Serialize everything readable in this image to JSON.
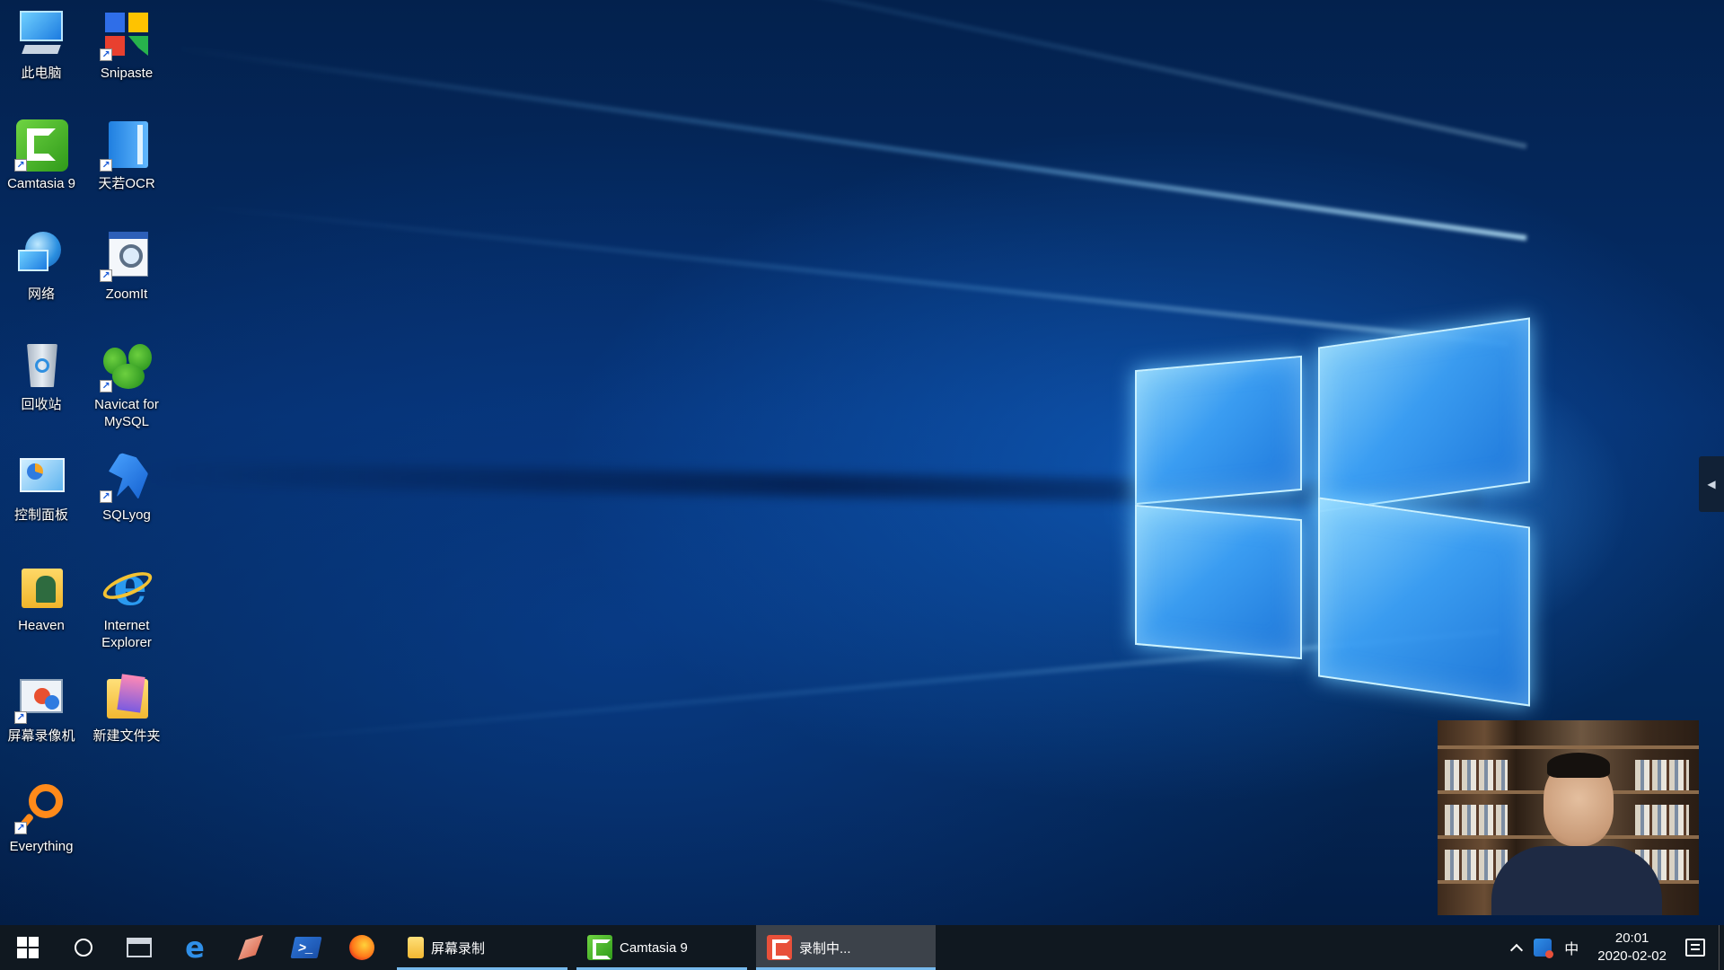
{
  "desktop": {
    "icons": [
      {
        "label": "此电脑",
        "icon": "computer-icon"
      },
      {
        "label": "Snipaste",
        "icon": "snipaste-icon"
      },
      {
        "label": "Camtasia 9",
        "icon": "camtasia-icon"
      },
      {
        "label": "天若OCR",
        "icon": "ocr-icon"
      },
      {
        "label": "网络",
        "icon": "network-icon"
      },
      {
        "label": "ZoomIt",
        "icon": "zoomit-icon"
      },
      {
        "label": "回收站",
        "icon": "recycle-bin-icon"
      },
      {
        "label": "Navicat for MySQL",
        "icon": "navicat-icon"
      },
      {
        "label": "控制面板",
        "icon": "control-panel-icon"
      },
      {
        "label": "SQLyog",
        "icon": "sqlyog-icon"
      },
      {
        "label": "Heaven",
        "icon": "folder-icon"
      },
      {
        "label": "Internet Explorer",
        "icon": "internet-explorer-icon"
      },
      {
        "label": "屏幕录像机",
        "icon": "screen-recorder-icon"
      },
      {
        "label": "新建文件夹",
        "icon": "folder-icon"
      },
      {
        "label": "Everything",
        "icon": "everything-icon"
      }
    ]
  },
  "taskbar": {
    "pinned": [
      {
        "icon": "start-icon"
      },
      {
        "icon": "cortana-icon"
      },
      {
        "icon": "task-view-icon"
      },
      {
        "icon": "edge-icon"
      },
      {
        "icon": "drawing-app-icon"
      },
      {
        "icon": "powershell-icon"
      },
      {
        "icon": "firefox-icon"
      }
    ],
    "apps": [
      {
        "label": "屏幕录制",
        "icon": "folder-icon"
      },
      {
        "label": "Camtasia 9",
        "icon": "camtasia-icon"
      },
      {
        "label": "录制中...",
        "icon": "recorder-icon"
      }
    ],
    "tray": {
      "ime": "中",
      "time": "20:01",
      "date": "2020-02-02"
    }
  },
  "colors": {
    "taskbar_bg": "#101820",
    "active_underline": "#76b9ed",
    "wallpaper_glow": "#46aaff"
  }
}
